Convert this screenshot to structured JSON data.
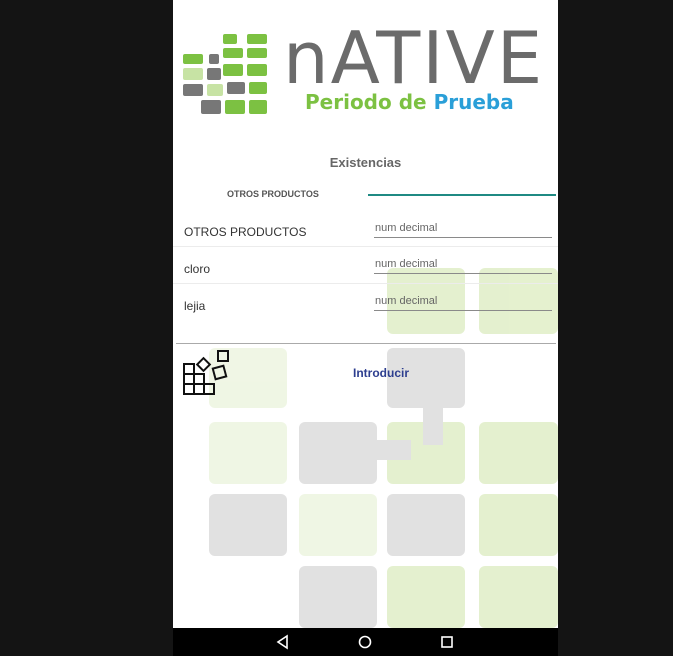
{
  "logo": {
    "word": "nATIVE",
    "subtitle_part1": "Periodo de",
    "subtitle_part2": "Prueba"
  },
  "screen": {
    "title": "Existencias"
  },
  "tabs": [
    {
      "label": "OTROS PRODUCTOS"
    }
  ],
  "rows": [
    {
      "label": "OTROS PRODUCTOS",
      "placeholder": "num decimal"
    },
    {
      "label": "cloro",
      "placeholder": "num decimal"
    },
    {
      "label": "lejia",
      "placeholder": "num decimal"
    }
  ],
  "actions": {
    "submit_label": "Introducir"
  },
  "colors": {
    "accent": "#1f8a83",
    "logo_green": "#7cc142",
    "logo_blue": "#2a9fd8",
    "button_text": "#2d3e8f"
  },
  "navbar": {
    "icons": [
      "back-triangle-icon",
      "home-circle-icon",
      "recents-square-icon"
    ]
  }
}
